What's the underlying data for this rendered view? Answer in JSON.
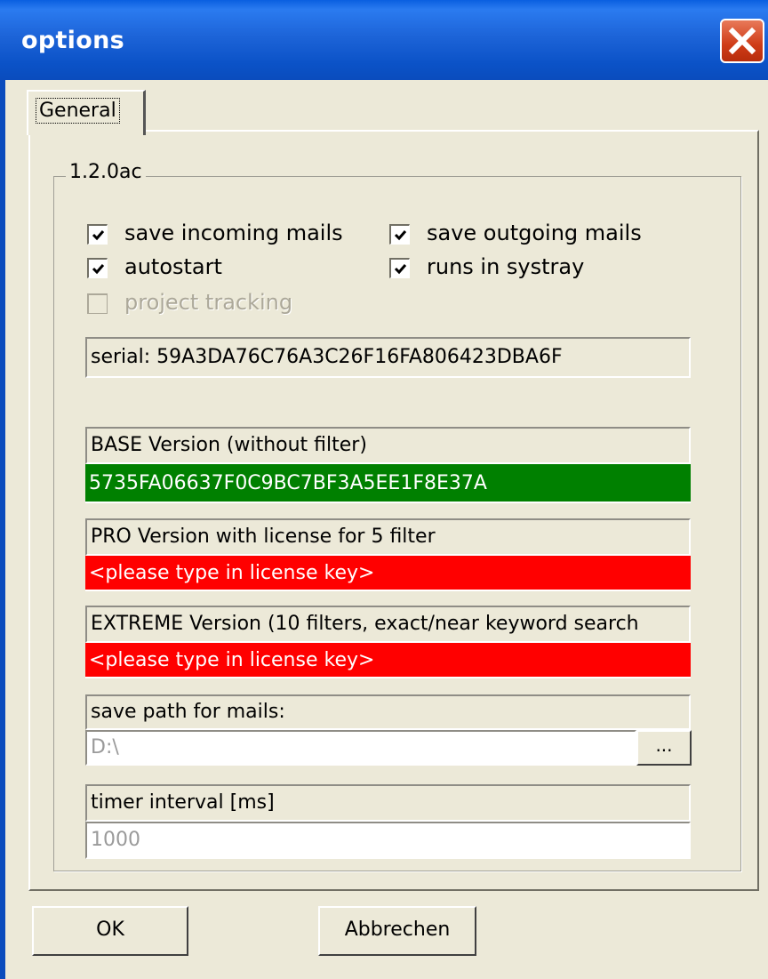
{
  "window": {
    "title": "options",
    "close_icon": "close-x-icon"
  },
  "tabs": [
    {
      "label": "General",
      "selected": true
    }
  ],
  "group": {
    "title": "1.2.0ac"
  },
  "checkboxes": {
    "save_incoming": {
      "label": "save incoming mails",
      "checked": true,
      "enabled": true
    },
    "save_outgoing": {
      "label": "save outgoing mails",
      "checked": true,
      "enabled": true
    },
    "autostart": {
      "label": "autostart",
      "checked": true,
      "enabled": true
    },
    "systray": {
      "label": "runs in systray",
      "checked": true,
      "enabled": true
    },
    "project_tracking": {
      "label": "project tracking",
      "checked": false,
      "enabled": false
    }
  },
  "serial": {
    "text": "serial: 59A3DA76C76A3C26F16FA806423DBA6F"
  },
  "base": {
    "label": "BASE Version (without filter)",
    "key": "5735FA06637F0C9BC7BF3A5EE1F8E37A",
    "color": "#008000"
  },
  "pro": {
    "label": "PRO Version with license for 5 filter",
    "key": "<please type in license key>",
    "color": "#ff0000"
  },
  "extreme": {
    "label": "EXTREME Version (10 filters, exact/near keyword search",
    "key": "<please type in license key>",
    "color": "#ff0000"
  },
  "save_path": {
    "label": "save path for mails:",
    "value": "D:\\",
    "browse_label": "..."
  },
  "timer": {
    "label": "timer interval [ms]",
    "value": "1000"
  },
  "buttons": {
    "ok": "OK",
    "cancel": "Abbrechen"
  }
}
